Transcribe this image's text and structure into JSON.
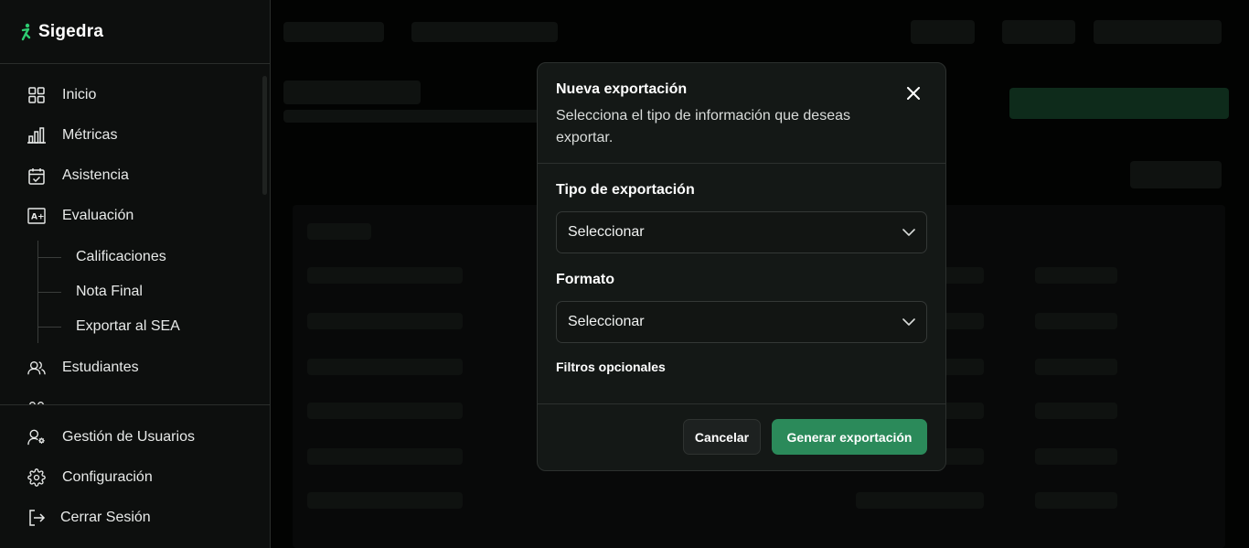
{
  "brand": {
    "name": "Sigedra",
    "accent": "#2ecc71"
  },
  "sidebar": {
    "items": [
      {
        "label": "Inicio",
        "icon": "grid-icon"
      },
      {
        "label": "Métricas",
        "icon": "bar-chart-icon"
      },
      {
        "label": "Asistencia",
        "icon": "calendar-check-icon"
      },
      {
        "label": "Evaluación",
        "icon": "grade-icon"
      }
    ],
    "sub_items": [
      "Calificaciones",
      "Nota Final",
      "Exportar al SEA"
    ],
    "more_items": [
      {
        "label": "Estudiantes",
        "icon": "users-icon"
      }
    ],
    "bottom_items": [
      {
        "label": "Gestión de Usuarios",
        "icon": "user-settings-icon"
      },
      {
        "label": "Configuración",
        "icon": "gear-icon"
      },
      {
        "label": "Cerrar Sesión",
        "icon": "logout-icon"
      }
    ]
  },
  "modal": {
    "title": "Nueva exportación",
    "subtitle": "Selecciona el tipo de información que deseas exportar.",
    "type_label": "Tipo de exportación",
    "type_value": "Seleccionar",
    "format_label": "Formato",
    "format_value": "Seleccionar",
    "filters_label": "Filtros opcionales",
    "cancel_label": "Cancelar",
    "submit_label": "Generar exportación",
    "submit_color": "#2b8a5a"
  }
}
